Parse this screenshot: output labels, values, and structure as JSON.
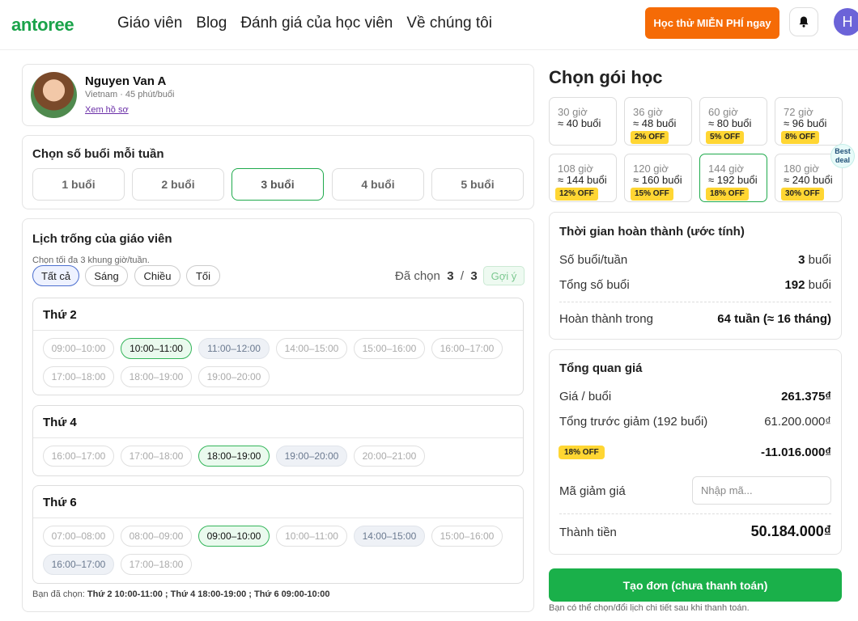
{
  "brand": "antoree",
  "nav": [
    "Giáo viên",
    "Blog",
    "Đánh giá của học viên",
    "Về chúng tôi"
  ],
  "cta_label": "Học thử MIỄN PHÍ ngay",
  "user_initial": "H",
  "tutor": {
    "name": "Nguyen Van A",
    "meta": "Vietnam · 45 phút/buổi",
    "profile_link": "Xem hồ sơ"
  },
  "sessions": {
    "title": "Chọn số buổi mỗi tuần",
    "options": [
      "1 buổi",
      "2 buổi",
      "3 buổi",
      "4 buổi",
      "5 buổi"
    ],
    "selected": "3 buổi"
  },
  "schedule": {
    "title": "Lịch trống của giáo viên",
    "note": "Chọn tối đa 3 khung giờ/tuần.",
    "filters": [
      "Tất cả",
      "Sáng",
      "Chiều",
      "Tối"
    ],
    "chosen_label": "Đã chọn",
    "chosen": "3",
    "slash": "/",
    "max": "3",
    "suggest": "Gợi ý",
    "days": [
      {
        "name": "Thứ 2",
        "slots": [
          {
            "t": "09:00–10:00",
            "s": "avail"
          },
          {
            "t": "10:00–11:00",
            "s": "sel"
          },
          {
            "t": "11:00–12:00",
            "s": "busy"
          },
          {
            "t": "14:00–15:00",
            "s": "avail"
          },
          {
            "t": "15:00–16:00",
            "s": "avail"
          },
          {
            "t": "16:00–17:00",
            "s": "avail"
          },
          {
            "t": "17:00–18:00",
            "s": "avail"
          },
          {
            "t": "18:00–19:00",
            "s": "avail"
          },
          {
            "t": "19:00–20:00",
            "s": "avail"
          }
        ]
      },
      {
        "name": "Thứ 4",
        "slots": [
          {
            "t": "16:00–17:00",
            "s": "avail"
          },
          {
            "t": "17:00–18:00",
            "s": "avail"
          },
          {
            "t": "18:00–19:00",
            "s": "sel"
          },
          {
            "t": "19:00–20:00",
            "s": "busy"
          },
          {
            "t": "20:00–21:00",
            "s": "avail"
          }
        ]
      },
      {
        "name": "Thứ 6",
        "slots": [
          {
            "t": "07:00–08:00",
            "s": "avail"
          },
          {
            "t": "08:00–09:00",
            "s": "avail"
          },
          {
            "t": "09:00–10:00",
            "s": "sel"
          },
          {
            "t": "10:00–11:00",
            "s": "avail"
          },
          {
            "t": "14:00–15:00",
            "s": "busy"
          },
          {
            "t": "15:00–16:00",
            "s": "avail"
          },
          {
            "t": "16:00–17:00",
            "s": "busy"
          },
          {
            "t": "17:00–18:00",
            "s": "avail"
          }
        ]
      }
    ],
    "summary_label": "Bạn đã chọn:",
    "summary_value": "Thứ 2 10:00-11:00 ; Thứ 4 18:00-19:00 ; Thứ 6 09:00-10:00"
  },
  "packages": {
    "title": "Chọn gói học",
    "items": [
      {
        "hours": "30 giờ",
        "sessions": "≈ 40 buổi",
        "badge": ""
      },
      {
        "hours": "36 giờ",
        "sessions": "≈ 48 buổi",
        "badge": "2% OFF"
      },
      {
        "hours": "60 giờ",
        "sessions": "≈ 80 buổi",
        "badge": "5% OFF"
      },
      {
        "hours": "72 giờ",
        "sessions": "≈ 96 buổi",
        "badge": "8% OFF"
      },
      {
        "hours": "108 giờ",
        "sessions": "≈ 144 buổi",
        "badge": "12% OFF"
      },
      {
        "hours": "120 giờ",
        "sessions": "≈ 160 buổi",
        "badge": "15% OFF"
      },
      {
        "hours": "144 giờ",
        "sessions": "≈ 192 buổi",
        "badge": "18% OFF"
      },
      {
        "hours": "180 giờ",
        "sessions": "≈ 240 buổi",
        "badge": "30% OFF"
      }
    ],
    "selected": "144 giờ",
    "best_deal": "Best deal"
  },
  "completion": {
    "title": "Thời gian hoàn thành (ước tính)",
    "per_week_label": "Số buổi/tuần",
    "per_week_value": "3",
    "per_week_unit": "buổi",
    "total_label": "Tổng số buổi",
    "total_value": "192",
    "total_unit": "buổi",
    "done_label": "Hoàn thành trong",
    "done_value": "64 tuần (≈ 16 tháng)"
  },
  "price": {
    "title": "Tổng quan giá",
    "per_session_label": "Giá / buổi",
    "per_session_value": "261.375₫",
    "before_label": "Tổng trước giảm (192 buổi)",
    "before_value": "61.200.000₫",
    "discount_badge": "18% OFF",
    "discount_value": "-11.016.000₫",
    "coupon_label": "Mã giảm giá",
    "coupon_placeholder": "Nhập mã...",
    "total_label": "Thành tiền",
    "total_value": "50.184.000₫"
  },
  "order_button": "Tạo đơn (chưa thanh toán)",
  "footer_note": "Bạn có thể chọn/đổi lịch chi tiết sau khi thanh toán."
}
